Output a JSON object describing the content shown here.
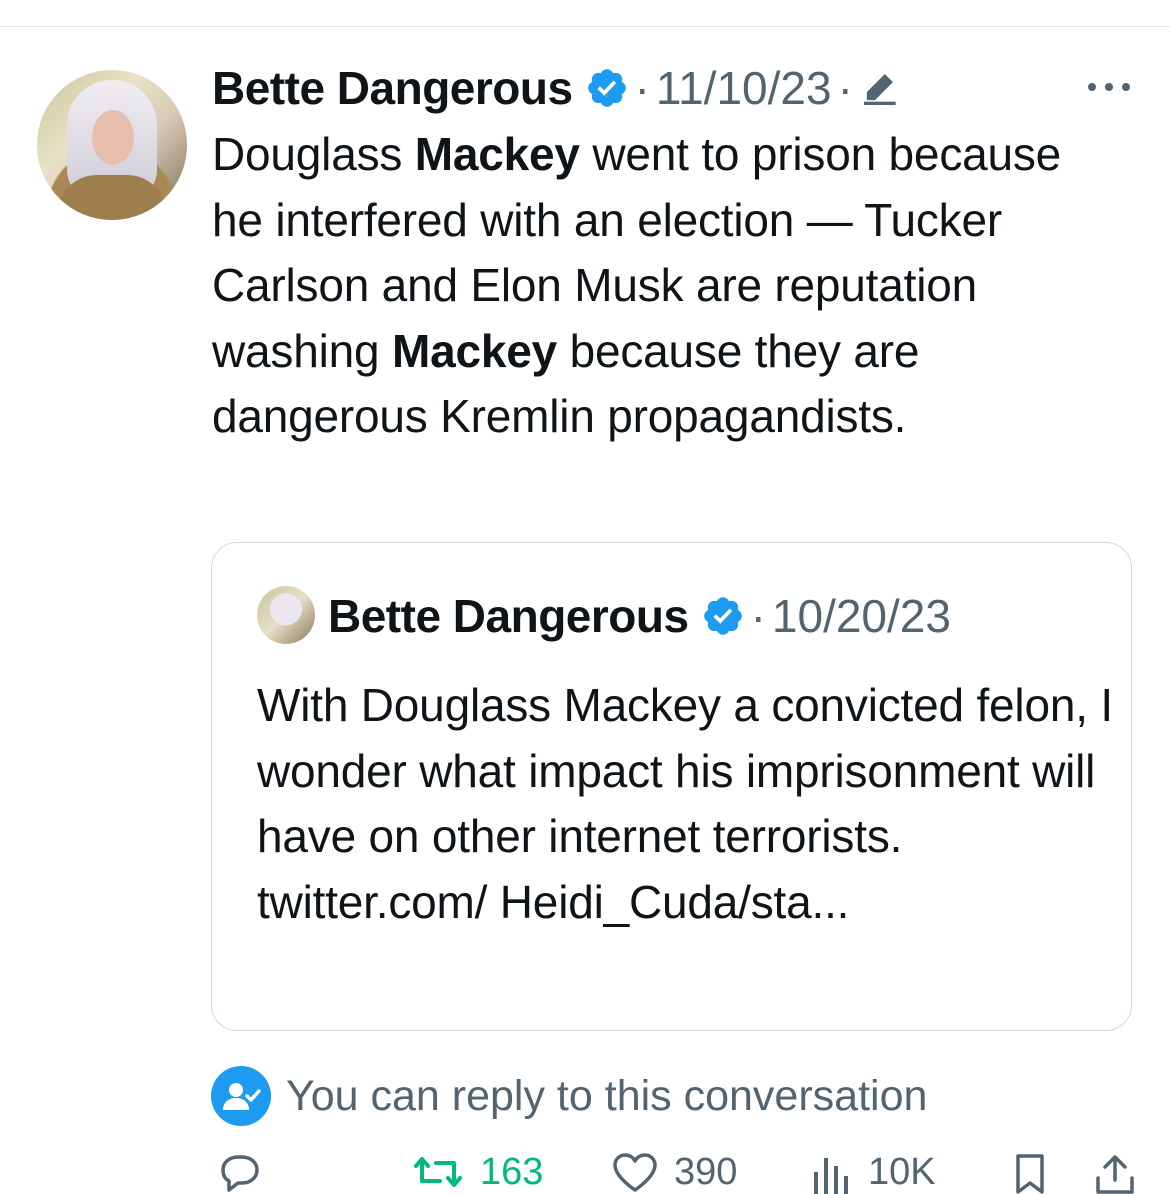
{
  "tweet": {
    "author": {
      "name": "Bette Dangerous",
      "verified_icon": "verified-badge-icon",
      "avatar": "profile-photo"
    },
    "separator": "·",
    "date": "11/10/23",
    "edited_icon": "pencil-icon",
    "more_icon": "more-horizontal-icon",
    "text_segments": [
      "Douglass ",
      "Mackey",
      " went to prison because he interfered with an election — Tucker Carlson and Elon Musk are reputation washing ",
      "Mackey",
      " because they are dangerous Kremlin propagandists."
    ]
  },
  "quoted_tweet": {
    "author_name": "Bette Dangerous",
    "separator": "·",
    "date": "10/20/23",
    "text": "With Douglass Mackey a convicted felon, I wonder what impact his imprisonment will have on other internet terrorists. twitter.com/ Heidi_Cuda/sta..."
  },
  "reply_notice": {
    "text": "You can reply to this conversation",
    "icon": "user-check-icon"
  },
  "actions": {
    "reply": {
      "icon": "comment-icon",
      "count": ""
    },
    "retweet": {
      "icon": "retweet-icon",
      "count": "163"
    },
    "like": {
      "icon": "heart-icon",
      "count": "390"
    },
    "views": {
      "icon": "bar-chart-icon",
      "count": "10K"
    },
    "bookmark": {
      "icon": "bookmark-icon"
    },
    "share": {
      "icon": "share-icon"
    }
  },
  "colors": {
    "verified": "#1d9bf0",
    "retweet_count": "#00ba7c",
    "secondary_text": "#536471"
  }
}
